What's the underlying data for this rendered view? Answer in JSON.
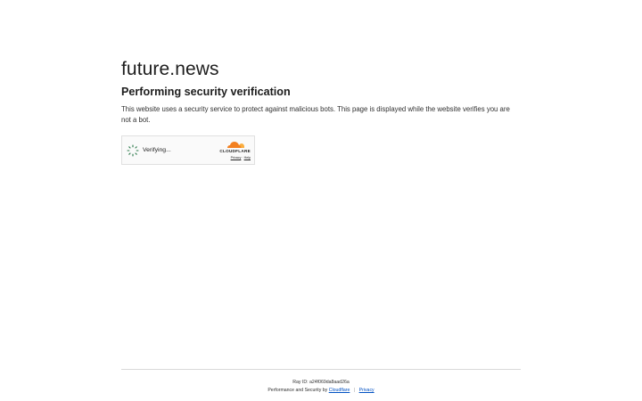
{
  "site": {
    "title": "future.news"
  },
  "main": {
    "heading": "Performing security verification",
    "description": "This website uses a security service to protect against malicious bots. This page is displayed while the website verifies you are not a bot."
  },
  "widget": {
    "status": "Verifying...",
    "brand": "CLOUDFLARE",
    "privacy_label": "Privacy",
    "link_separator": "·",
    "help_label": "Help",
    "spinner_icon": "loading-spinner-icon",
    "logo_icon": "cloudflare-cloud-icon",
    "colors": {
      "cloud_primary": "#f38020",
      "cloud_secondary": "#faae40"
    }
  },
  "footer": {
    "ray_id": "Ray ID: a24f069da8aad26a",
    "perf_text": "Performance and Security by",
    "cloudflare_link": "Cloudflare",
    "separator": "|",
    "privacy_link": "Privacy",
    "link_color": "#0051c3"
  }
}
